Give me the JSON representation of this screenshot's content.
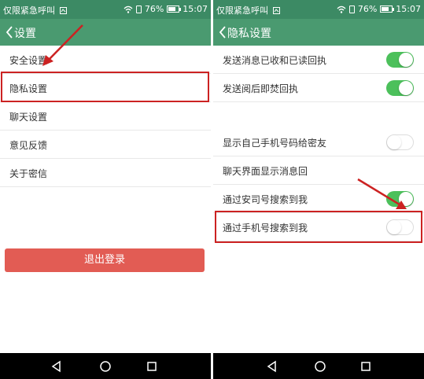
{
  "colors": {
    "status_bar": "#3c8a64",
    "app_bar": "#4a9a70",
    "toggle_on": "#4cc05b",
    "logout_button": "#e25c54",
    "highlight": "#cc2222",
    "nav_bar": "#000000"
  },
  "status_bar": {
    "carrier": "仅限紧急呼叫",
    "battery_level": 0.76,
    "battery_text": "76%",
    "time": "15:07",
    "icons": [
      "notification-icon",
      "wifi-icon",
      "sim-icon",
      "battery-icon"
    ]
  },
  "left_screen": {
    "title": "设置",
    "items": [
      {
        "label": "安全设置"
      },
      {
        "label": "隐私设置"
      },
      {
        "label": "聊天设置"
      },
      {
        "label": "意见反馈"
      },
      {
        "label": "关于密信"
      }
    ],
    "logout_label": "退出登录"
  },
  "right_screen": {
    "title": "隐私设置",
    "items": [
      {
        "label": "发送消息已收和已读回执",
        "enabled": true
      },
      {
        "label": "发送阅后即焚回执",
        "enabled": true
      },
      {
        "label": "显示自己手机号码给密友",
        "enabled": false
      },
      {
        "label": "聊天界面显示消息回",
        "enabled": null
      },
      {
        "label": "通过安司号搜索到我",
        "enabled": true
      },
      {
        "label": "通过手机号搜索到我",
        "enabled": false
      }
    ]
  },
  "nav_bar": {
    "icons": [
      "back-triangle-icon",
      "home-circle-icon",
      "recents-square-icon"
    ]
  }
}
